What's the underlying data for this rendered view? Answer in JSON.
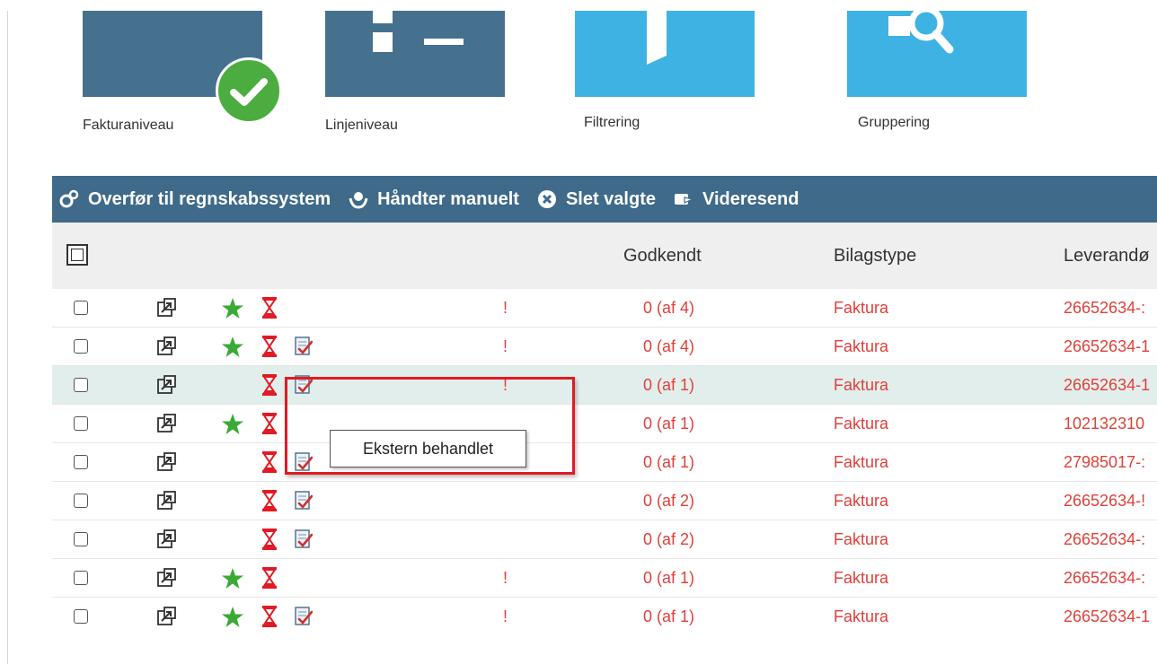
{
  "views": {
    "tiles": [
      {
        "label": "Fakturaniveau",
        "icon": "invoice-level-icon",
        "selected": true
      },
      {
        "label": "Linjeniveau",
        "icon": "line-level-icon",
        "selected": false
      },
      {
        "label": "Filtrering",
        "icon": "filter-icon",
        "selected": false
      },
      {
        "label": "Gruppering",
        "icon": "grouping-icon",
        "selected": false
      }
    ]
  },
  "toolbar": {
    "transfer_label": "Overfør til regnskabssystem",
    "manual_label": "Håndter manuelt",
    "delete_label": "Slet valgte",
    "forward_label": "Videresend"
  },
  "table": {
    "columns": [
      "Godkendt",
      "Bilagstype",
      "Leverandø"
    ],
    "rows": [
      {
        "starred": true,
        "pending": true,
        "note": false,
        "warning": true,
        "approved": "0 (af 4)",
        "type": "Faktura",
        "supplier": "26652634-:"
      },
      {
        "starred": true,
        "pending": true,
        "note": true,
        "warning": true,
        "approved": "0 (af 4)",
        "type": "Faktura",
        "supplier": "26652634-1"
      },
      {
        "starred": false,
        "pending": true,
        "note": true,
        "warning": true,
        "approved": "0 (af 1)",
        "type": "Faktura",
        "supplier": "26652634-1"
      },
      {
        "starred": true,
        "pending": true,
        "note": false,
        "warning": false,
        "approved": "0 (af 1)",
        "type": "Faktura",
        "supplier": "102132310"
      },
      {
        "starred": false,
        "pending": true,
        "note": true,
        "warning": false,
        "approved": "0 (af 1)",
        "type": "Faktura",
        "supplier": "27985017-:"
      },
      {
        "starred": false,
        "pending": true,
        "note": true,
        "warning": false,
        "approved": "0 (af 2)",
        "type": "Faktura",
        "supplier": "26652634-!"
      },
      {
        "starred": false,
        "pending": true,
        "note": true,
        "warning": false,
        "approved": "0 (af 2)",
        "type": "Faktura",
        "supplier": "26652634-:"
      },
      {
        "starred": true,
        "pending": true,
        "note": false,
        "warning": true,
        "approved": "0 (af 1)",
        "type": "Faktura",
        "supplier": "26652634-:"
      },
      {
        "starred": true,
        "pending": true,
        "note": true,
        "warning": true,
        "approved": "0 (af 1)",
        "type": "Faktura",
        "supplier": "26652634-1"
      }
    ],
    "warning_symbol": "!"
  },
  "tooltip": {
    "text": "Ekstern behandlet"
  },
  "colors": {
    "tile_dark": "#45718f",
    "tile_light": "#3eb3e3",
    "toolbar": "#3f6a8a",
    "status_red": "#e0403a",
    "star_green": "#3aaa35",
    "highlight_row": "#e2eeec"
  }
}
